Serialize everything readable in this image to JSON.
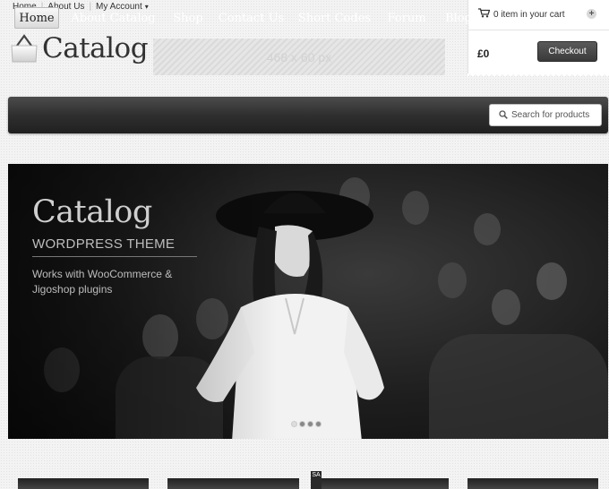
{
  "top_links": {
    "home": "Home",
    "about": "About Us",
    "account": "My Account"
  },
  "logo": {
    "text": "Catalog"
  },
  "banner": {
    "text": "468 x 60 px"
  },
  "cart": {
    "status": "0 item in your cart",
    "total": "£0",
    "checkout_label": "Checkout"
  },
  "nav": {
    "items": [
      "Home",
      "About Catalog",
      "Shop",
      "Contact Us",
      "Short Codes",
      "Forum",
      "Blog"
    ],
    "active_index": 0
  },
  "search": {
    "placeholder": "Search for products"
  },
  "slider": {
    "title": "Catalog",
    "subtitle": "WORDPRESS THEME",
    "description": "Works with WooCommerce & Jigoshop plugins",
    "slide_count": 4,
    "active_slide": 0
  },
  "products": {
    "sale_label": "SA"
  },
  "colors": {
    "navbar": "#2f2f2f",
    "accent_button": "#4a4a4a",
    "background": "#f3f3f3"
  }
}
